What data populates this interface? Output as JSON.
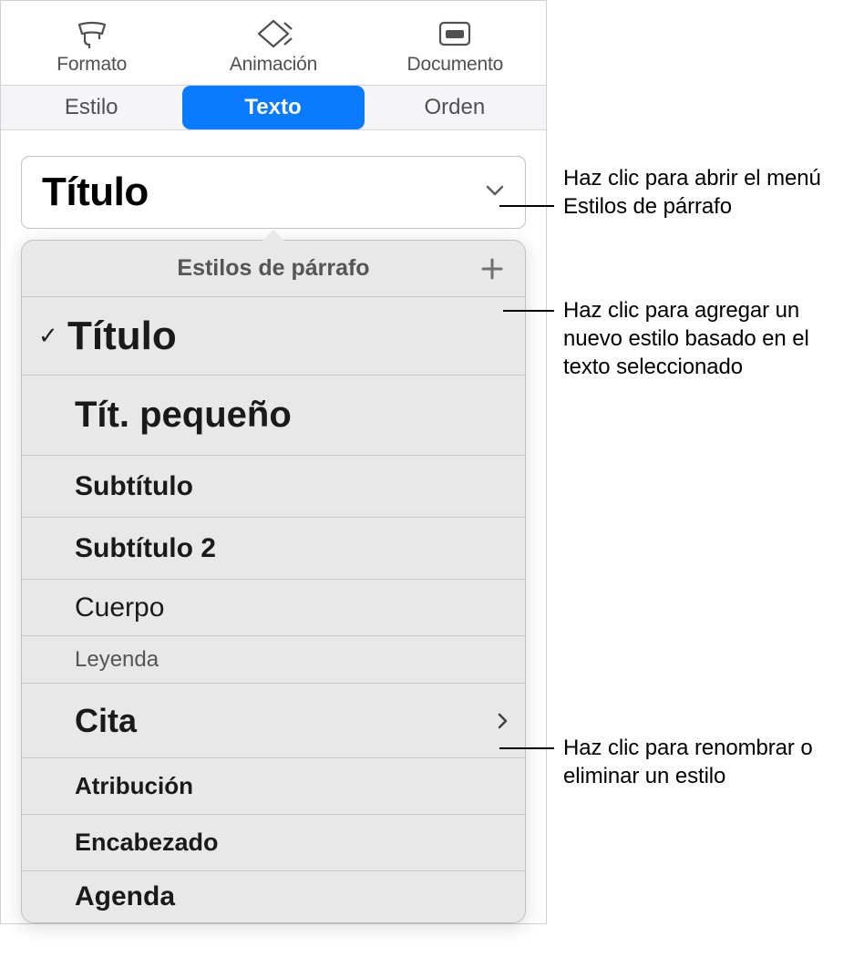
{
  "toolbar": {
    "format": "Formato",
    "animation": "Animación",
    "document": "Documento"
  },
  "tabs": {
    "style": "Estilo",
    "text": "Texto",
    "order": "Orden"
  },
  "selector": {
    "current": "Título"
  },
  "popover": {
    "title": "Estilos de párrafo",
    "items": [
      {
        "label": "Título",
        "checked": true,
        "chevron": false
      },
      {
        "label": "Tít. pequeño",
        "checked": false,
        "chevron": false
      },
      {
        "label": "Subtítulo",
        "checked": false,
        "chevron": false
      },
      {
        "label": "Subtítulo 2",
        "checked": false,
        "chevron": false
      },
      {
        "label": "Cuerpo",
        "checked": false,
        "chevron": false
      },
      {
        "label": "Leyenda",
        "checked": false,
        "chevron": false
      },
      {
        "label": "Cita",
        "checked": false,
        "chevron": true
      },
      {
        "label": "Atribución",
        "checked": false,
        "chevron": false
      },
      {
        "label": "Encabezado",
        "checked": false,
        "chevron": false
      },
      {
        "label": "Agenda",
        "checked": false,
        "chevron": false
      }
    ]
  },
  "callouts": {
    "open_menu": "Haz clic para abrir el menú Estilos de párrafo",
    "add_style": "Haz clic para agregar un nuevo estilo basado en el texto seleccionado",
    "rename_delete": "Haz clic para renombrar o eliminar un estilo"
  }
}
